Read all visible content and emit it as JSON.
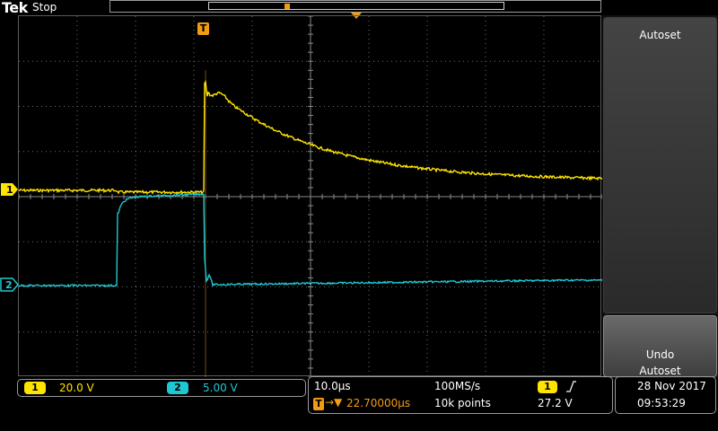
{
  "header": {
    "logo": "Tek",
    "run_status": "Stop"
  },
  "markers": {
    "trigger_label": "T",
    "ch1_label": "1",
    "ch2_label": "2"
  },
  "side_menu": {
    "autoset_label": "Autoset",
    "undo_label": "Undo\nAutoset"
  },
  "channels": [
    {
      "label": "1",
      "scale": "20.0 V",
      "color": "#ffe400"
    },
    {
      "label": "2",
      "scale": "5.00 V",
      "color": "#1ec8d2"
    }
  ],
  "timing": {
    "horizontal_scale": "10.0μs",
    "sample_rate": "100MS/s",
    "trigger_channel": "1",
    "trigger_slope_icon": "rising-edge-icon",
    "trigger_level": "27.2 V",
    "trigger_position": "22.70000μs",
    "record_length": "10k points"
  },
  "datetime": {
    "date": "28 Nov 2017",
    "time": "09:53:29"
  },
  "colors": {
    "ch1": "#ffe400",
    "ch2": "#1ec8d2",
    "trigger": "#f39c12",
    "grid": "#6e6e6e"
  }
}
